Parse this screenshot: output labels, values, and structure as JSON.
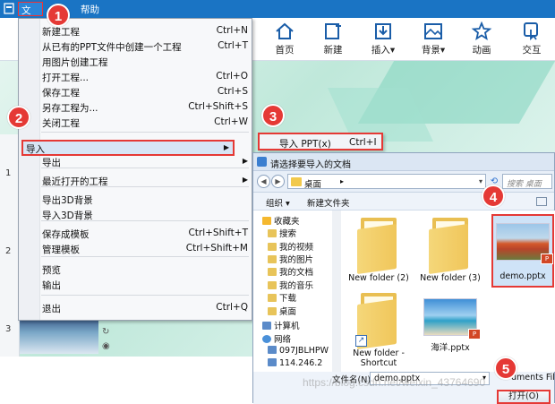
{
  "menubar": {
    "items": [
      "文件",
      "帮助"
    ]
  },
  "ribbon": {
    "buttons": [
      {
        "label": "首页",
        "icon": "home-icon"
      },
      {
        "label": "新建",
        "icon": "new-slide-icon"
      },
      {
        "label": "插入▾",
        "icon": "insert-icon"
      },
      {
        "label": "背景▾",
        "icon": "background-icon"
      },
      {
        "label": "动画",
        "icon": "animation-icon"
      },
      {
        "label": "交互",
        "icon": "interaction-icon"
      }
    ]
  },
  "file_menu": {
    "items": [
      {
        "label": "新建工程",
        "shortcut": "Ctrl+N"
      },
      {
        "label": "从已有的PPT文件中创建一个工程",
        "shortcut": "Ctrl+T"
      },
      {
        "label": "用图片创建工程",
        "shortcut": ""
      },
      {
        "label": "打开工程...",
        "shortcut": "Ctrl+O"
      },
      {
        "label": "保存工程",
        "shortcut": "Ctrl+S"
      },
      {
        "label": "另存工程为...",
        "shortcut": "Ctrl+Shift+S"
      },
      {
        "label": "关闭工程",
        "shortcut": "Ctrl+W"
      },
      {
        "label": "导入",
        "shortcut": ""
      },
      {
        "label": "导出",
        "shortcut": ""
      },
      {
        "label": "最近打开的工程",
        "shortcut": ""
      },
      {
        "label": "导出3D背景",
        "shortcut": ""
      },
      {
        "label": "导入3D背景",
        "shortcut": ""
      },
      {
        "label": "保存成模板",
        "shortcut": "Ctrl+Shift+T"
      },
      {
        "label": "管理模板",
        "shortcut": "Ctrl+Shift+M"
      },
      {
        "label": "预览",
        "shortcut": ""
      },
      {
        "label": "输出",
        "shortcut": ""
      },
      {
        "label": "退出",
        "shortcut": "Ctrl+Q"
      }
    ]
  },
  "import_submenu": {
    "label": "导入 PPT(x)",
    "shortcut": "Ctrl+I"
  },
  "slides": {
    "numbers": [
      "1",
      "2",
      "3"
    ]
  },
  "dialog": {
    "title": "请选择要导入的文档",
    "path": "桌面",
    "search_placeholder": "搜索 桌面",
    "toolbar": {
      "organize": "组织 ▾",
      "new_folder": "新建文件夹"
    },
    "tree": [
      {
        "label": "收藏夹",
        "icon": "star-icon"
      },
      {
        "label": "搜索",
        "icon": "folder-icon"
      },
      {
        "label": "我的视频",
        "icon": "folder-icon"
      },
      {
        "label": "我的图片",
        "icon": "folder-icon"
      },
      {
        "label": "我的文档",
        "icon": "folder-icon"
      },
      {
        "label": "我的音乐",
        "icon": "folder-icon"
      },
      {
        "label": "下载",
        "icon": "folder-icon"
      },
      {
        "label": "桌面",
        "icon": "folder-icon"
      },
      {
        "label": "计算机",
        "icon": "computer-icon"
      },
      {
        "label": "网络",
        "icon": "network-icon"
      },
      {
        "label": "097JBLHPW",
        "icon": "computer-icon"
      },
      {
        "label": "114.246.2",
        "icon": "computer-icon"
      }
    ],
    "files": [
      {
        "name": "New folder (2)",
        "kind": "folder"
      },
      {
        "name": "New folder (3)",
        "kind": "folder"
      },
      {
        "name": "demo.pptx",
        "kind": "pptx"
      },
      {
        "name": "New folder - Shortcut",
        "kind": "shortcut"
      },
      {
        "name": "海洋.pptx",
        "kind": "pptx"
      }
    ],
    "filename_label": "文件名(N):",
    "filename_value": "demo.pptx",
    "filetype": "uments File(*",
    "open_button": "打开(O)"
  },
  "steps": [
    "1",
    "2",
    "3",
    "4",
    "5"
  ],
  "watermark": "https://blog.csdn.net/weixin_43764690",
  "colors": {
    "accent": "#1a74c4",
    "highlight": "#e53935"
  }
}
